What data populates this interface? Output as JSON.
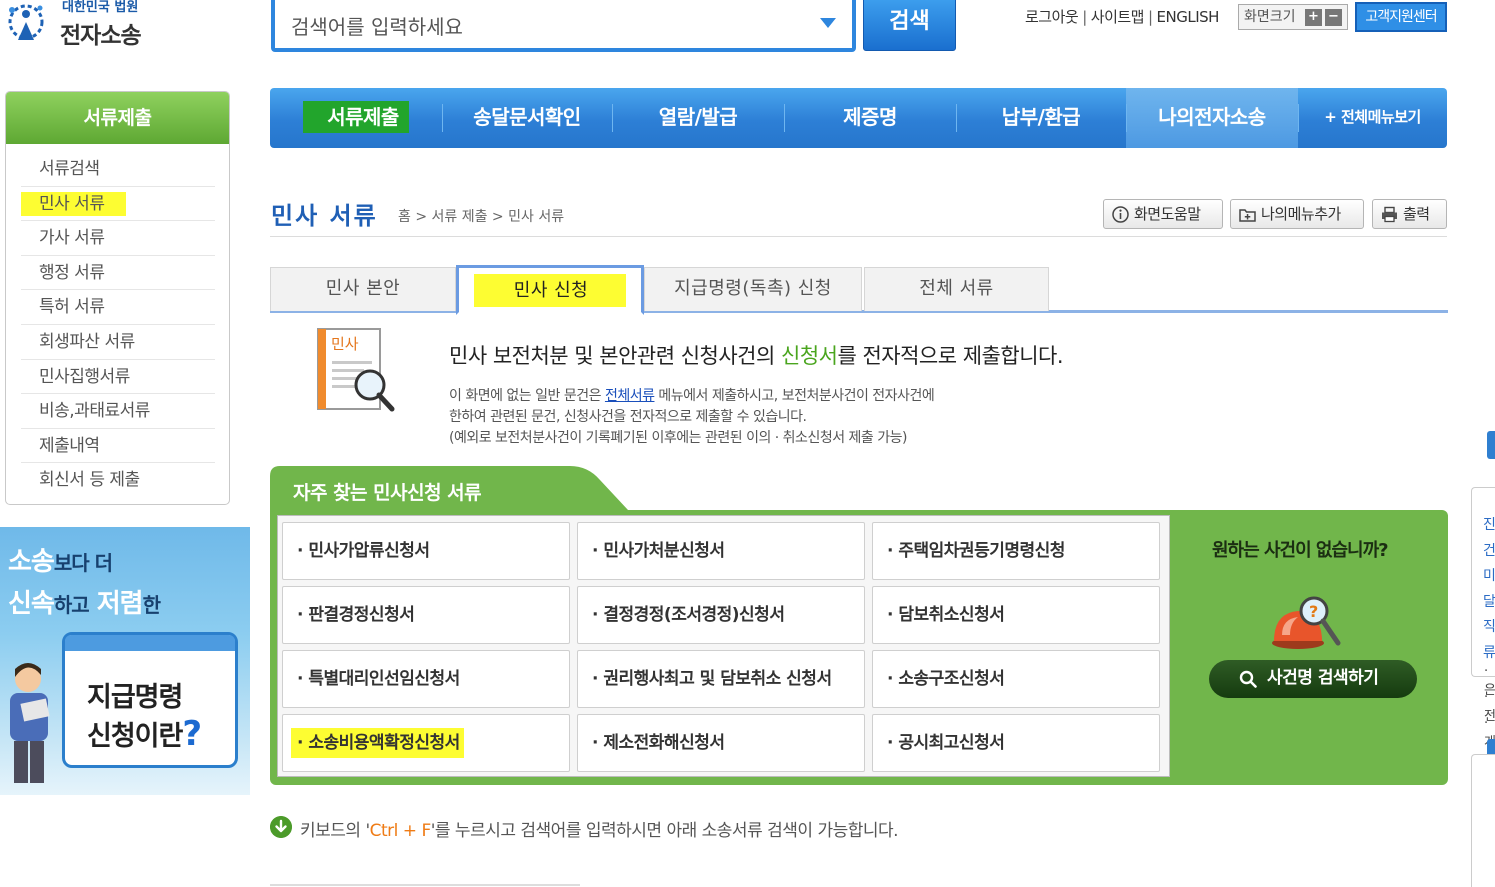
{
  "header": {
    "logo_small": "대한민국 법원",
    "logo_big": "전자소송",
    "search_placeholder": "검색어를 입력하세요",
    "search_button": "검색",
    "links": [
      "로그아웃",
      "사이트맵",
      "ENGLISH"
    ],
    "screen_size_label": "화면크기",
    "zoom_in": "+",
    "zoom_out": "−",
    "customer_center": "고객지원센터"
  },
  "sidebar": {
    "title": "서류제출",
    "items": [
      {
        "label": "서류검색"
      },
      {
        "label": "민사 서류"
      },
      {
        "label": "가사 서류"
      },
      {
        "label": "행정 서류"
      },
      {
        "label": "특허 서류"
      },
      {
        "label": "회생파산 서류"
      },
      {
        "label": "민사집행서류"
      },
      {
        "label": "비송,과태료서류"
      },
      {
        "label": "제출내역"
      },
      {
        "label": "회신서 등 제출"
      }
    ],
    "highlighted_index": 1
  },
  "banner": {
    "line1_big1": "소송",
    "line1_small": "보다 더",
    "line2_big1": "신속",
    "line2_small1": "하고",
    "line2_big2": "저렴",
    "line2_small2": "한",
    "cal_line1": "지급명령",
    "cal_line2": "신청이란",
    "cal_q": "?"
  },
  "nav": {
    "items": [
      {
        "label": "서류제출"
      },
      {
        "label": "송달문서확인"
      },
      {
        "label": "열람/발급"
      },
      {
        "label": "제증명"
      },
      {
        "label": "납부/환급"
      },
      {
        "label": "나의전자소송"
      },
      {
        "label": "+ 전체메뉴보기"
      }
    ]
  },
  "page": {
    "title": "민사 서류",
    "breadcrumb": "홈 > 서류 제출 > 민사 서류",
    "help_button": "화면도움말",
    "add_menu_button": "나의메뉴추가",
    "print_button": "출력"
  },
  "tabs": [
    {
      "label": "민사 본안",
      "active": false
    },
    {
      "label": "민사 신청",
      "active": true
    },
    {
      "label": "지급명령(독촉) 신청",
      "active": false
    },
    {
      "label": "전체 서류",
      "active": false
    }
  ],
  "description": {
    "icon_label": "민사",
    "title_pre": "민사 보전처분 및 본안관련 신청사건의 ",
    "title_green": "신청서",
    "title_post": "를 전자적으로 제출합니다.",
    "line1_pre": "이 화면에 없는 일반 문건은 ",
    "line1_link": "전체서류",
    "line1_post": " 메뉴에서 제출하시고, 보전처분사건이 전자사건에",
    "line2": "한하여 관련된 문건, 신청사건을 전자적으로 제출할 수 있습니다.",
    "line3": "(예외로 보전처분사건이 기록폐기된 이후에는 관련된 이의 · 취소신청서 제출 가능)"
  },
  "frequent": {
    "title": "자주 찾는 민사신청 서류",
    "docs": [
      {
        "label": "· 민사가압류신청서"
      },
      {
        "label": "· 민사가처분신청서"
      },
      {
        "label": "· 주택임차권등기명령신청"
      },
      {
        "label": "· 판결경정신청서"
      },
      {
        "label": "· 결정경정(조서경정)신청서"
      },
      {
        "label": "· 담보취소신청서"
      },
      {
        "label": "· 특별대리인선임신청서"
      },
      {
        "label": "· 권리행사최고 및 담보취소 신청서"
      },
      {
        "label": "· 소송구조신청서"
      },
      {
        "label": "· 소송비용액확정신청서"
      },
      {
        "label": "· 제소전화해신청서"
      },
      {
        "label": "· 공시최고신청서"
      }
    ],
    "highlighted_index": 9,
    "nocase_text": "원하는 사건이 없습니까?",
    "case_search_button": "사건명 검색하기"
  },
  "notice": {
    "pre": "키보드의 '",
    "key": "Ctrl + F",
    "post": "'를 누르시고 검색어를 입력하시면 아래 소송서류 검색이 가능합니다."
  },
  "quick_menu": {
    "text": "진건미달직류",
    "bullets": [
      "·은",
      "·전",
      "·개"
    ]
  },
  "colors": {
    "primary_blue": "#2d7fd6",
    "green": "#71b64b",
    "highlight_yellow": "#fdfd32",
    "title_blue": "#1f5fb5"
  }
}
